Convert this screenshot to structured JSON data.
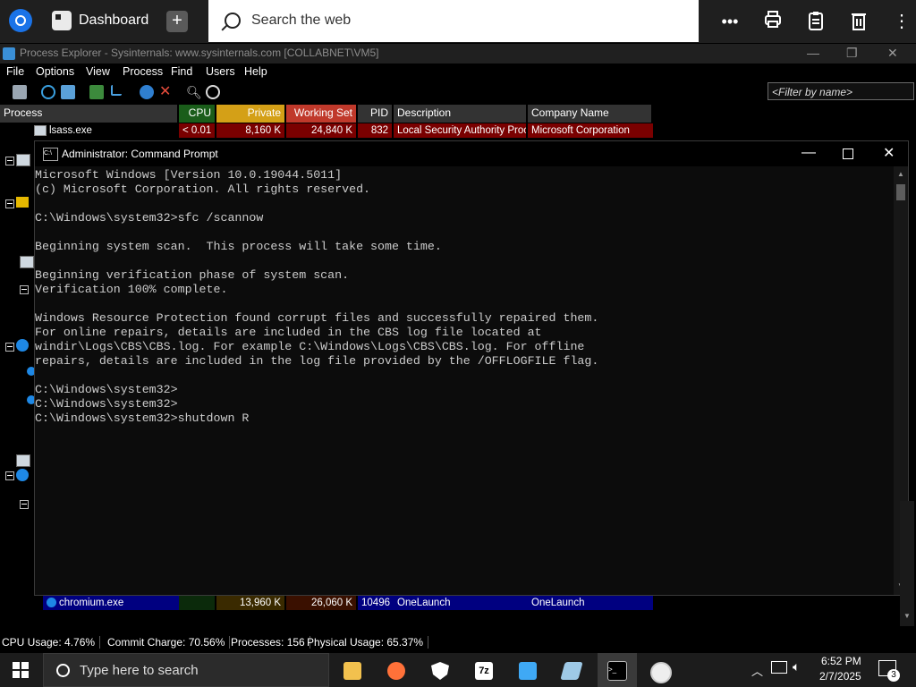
{
  "browser": {
    "tab_label": "Dashboard",
    "search_placeholder": "Search the web"
  },
  "process_explorer": {
    "title": "Process Explorer - Sysinternals: www.sysinternals.com [COLLABNET\\VM5]",
    "menu": [
      "File",
      "Options",
      "View",
      "Process",
      "Find",
      "Users",
      "Help"
    ],
    "filter_placeholder": "<Filter by name>",
    "columns": [
      "Process",
      "CPU",
      "Private Bytes",
      "Working Set",
      "PID",
      "Description",
      "Company Name"
    ],
    "rows": [
      {
        "process": "lsass.exe",
        "cpu": "< 0.01",
        "private_bytes": "8,160 K",
        "working_set": "24,840 K",
        "pid": "832",
        "description": "Local Security Authority Proc...",
        "company": "Microsoft Corporation"
      },
      {
        "process": "chromium.exe",
        "cpu": "",
        "private_bytes": "13,960 K",
        "working_set": "26,060 K",
        "pid": "10496",
        "description": "OneLaunch",
        "company": "OneLaunch"
      }
    ],
    "status": {
      "cpu": "CPU Usage: 4.76%",
      "commit": "Commit Charge: 70.56%",
      "processes": "Processes: 156",
      "physical": "Physical Usage: 65.37%"
    },
    "colors": {
      "row_red": "#7a0000",
      "row_blue": "#000080",
      "cpu_hdr": "#1a5d1a",
      "bytes_hdr": "#d4a017",
      "ws_hdr": "#c0392b"
    }
  },
  "cmd": {
    "title": "Administrator: Command Prompt",
    "lines": "Microsoft Windows [Version 10.0.19044.5011]\n(c) Microsoft Corporation. All rights reserved.\n\nC:\\Windows\\system32>sfc /scannow\n\nBeginning system scan.  This process will take some time.\n\nBeginning verification phase of system scan.\nVerification 100% complete.\n\nWindows Resource Protection found corrupt files and successfully repaired them.\nFor online repairs, details are included in the CBS log file located at\nwindir\\Logs\\CBS\\CBS.log. For example C:\\Windows\\Logs\\CBS\\CBS.log. For offline\nrepairs, details are included in the log file provided by the /OFFLOGFILE flag.\n\nC:\\Windows\\system32>\nC:\\Windows\\system32>\nC:\\Windows\\system32>shutdown R"
  },
  "taskbar": {
    "search_placeholder": "Type here to search",
    "time": "6:52 PM",
    "date": "2/7/2025",
    "notification_count": "3",
    "apps": [
      "file-explorer-icon",
      "firefox-icon",
      "security-icon",
      "7zip-icon",
      "onelaunch-search-icon",
      "notepad-icon",
      "command-prompt-icon",
      "clock-app-icon"
    ]
  }
}
